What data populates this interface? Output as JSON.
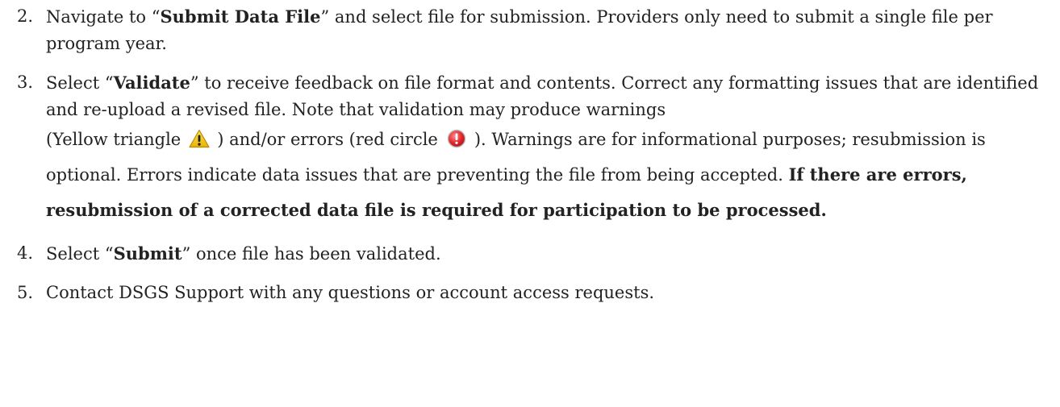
{
  "steps": [
    {
      "number": "2.",
      "pre": "Navigate to “",
      "bold": "Submit Data File",
      "post": "” and select file for submission. Providers only need to submit a single file per program year."
    },
    {
      "number": "3.",
      "pre": "Select “",
      "bold": "Validate",
      "post": "” to receive feedback on file format and contents. Correct any formatting issues that are identified and re-upload a revised file. Note that validation may produce warnings",
      "warn_text_pre": "(Yellow triangle",
      "warn_text_mid": ") and/or errors (red circle",
      "warn_text_post": "). Warnings are for informational purposes; resubmission is optional. Errors indicate data issues that are preventing the file from being accepted. ",
      "bold_tail": "If there are errors, resubmission of a corrected data file is required for participation to be processed.",
      "warning_icon": "warning-triangle-icon",
      "error_icon": "error-circle-icon",
      "warning_color": "#f2c200",
      "error_color": "#d0262a"
    },
    {
      "number": "4.",
      "pre": "Select “",
      "bold": "Submit",
      "post": "” once file has been validated."
    },
    {
      "number": "5.",
      "text": "Contact DSGS Support with any questions or account access requests."
    }
  ]
}
